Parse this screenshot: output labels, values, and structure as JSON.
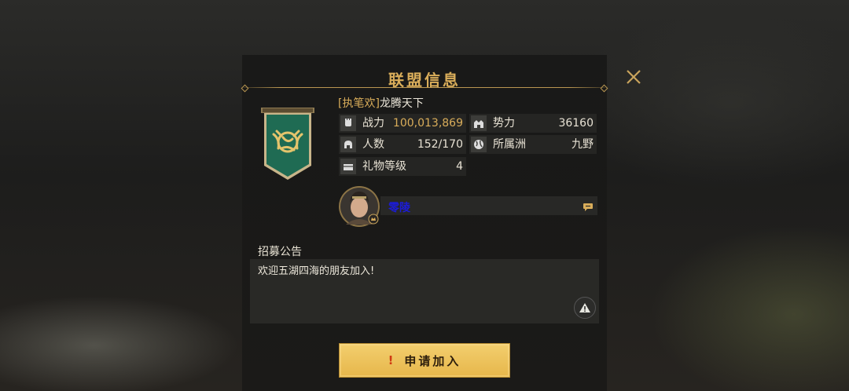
{
  "dialog": {
    "title": "联盟信息"
  },
  "alliance": {
    "tag": "[执笔欢]",
    "name": "龙腾天下"
  },
  "stats": {
    "combat_power": {
      "label": "战力",
      "value": "100,013,869",
      "icon": "fist-icon"
    },
    "influence": {
      "label": "势力",
      "value": "36160",
      "icon": "castle-icon"
    },
    "members": {
      "label": "人数",
      "value": "152/170",
      "icon": "helmet-icon"
    },
    "region": {
      "label": "所属洲",
      "value": "九野",
      "icon": "globe-icon"
    },
    "gift_level": {
      "label": "礼物等级",
      "value": "4",
      "icon": "gift-icon"
    }
  },
  "leader": {
    "name": "零陵"
  },
  "recruitment": {
    "title": "招募公告",
    "text": "欢迎五湖四海的朋友加入!"
  },
  "actions": {
    "apply_warn": "!",
    "apply_label": "申请加入"
  },
  "colors": {
    "accent_gold": "#d9ad5a",
    "banner_green": "#1f6b53",
    "button_gold": "#e6b64a",
    "leader_name": "#1c1cd8"
  }
}
